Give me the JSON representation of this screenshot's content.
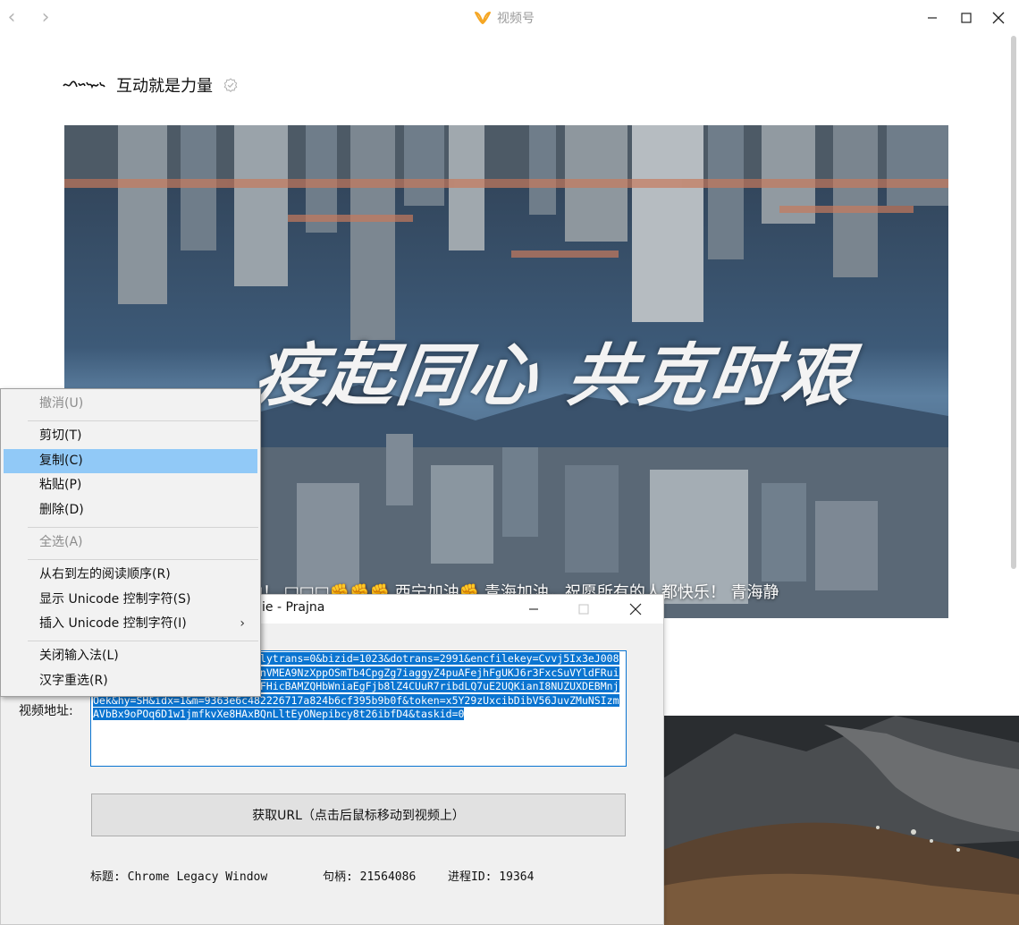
{
  "window": {
    "title": "视频号",
    "back_icon": "chevron-left-icon",
    "forward_icon": "chevron-right-icon",
    "logo_icon": "channels-logo-icon"
  },
  "post": {
    "author_name": "互动就是力量",
    "verified_icon": "verified-badge-icon",
    "avatar_icon": "handwritten-logo-avatar",
    "video_overlay_text": "疫起同心 共克时艰",
    "danmaku_text": "西宁加油！ □□□✊✊✊ 西宁加油✊ 青海加油，祝愿所有的人都快乐！ 青海静"
  },
  "dialog": {
    "title": "ie - Prajna",
    "url_label": "视频地址:",
    "url_value": "om/251/20302/stodownload?X-lytrans=0&bizid=1023&dotrans=2991&encfilekey=Cvvj5Ix3eJ00808a7aXgoTGR4hoqgnC4WQz8kVyxnVMEA9NzXppOSmTb4CpgZg7iaggyZ4puAFejhFgUKJ6r3FxcSuVYldFRuibSRNoFFWf7jTcqWld9hPaOPkXFFFHicBAMZQHbWniaEgFjb8lZ4CUuR7ribdLQ7uE2UQKianI8NUZUXDEBMnjOek&hy=SH&idx=1&m=9363e6c482226717a824b6cf395b9b0f&token=x5Y29zUxcibDibV56JuvZMuNSIzmAVbBx9oPOq6D1w1jmfkvXe8HAxBQnLltEyONepibcy8t26ibfD4&taskid=0",
    "get_url_button": "获取URL（点击后鼠标移动到视频上）",
    "status_title": "标题: Chrome Legacy Window",
    "status_handle": "句柄: 21564086",
    "status_pid": "进程ID: 19364"
  },
  "context_menu": {
    "items": [
      {
        "label": "撤消(U)"
      },
      {
        "label": "剪切(T)"
      },
      {
        "label": "复制(C)"
      },
      {
        "label": "粘贴(P)"
      },
      {
        "label": "删除(D)"
      },
      {
        "label": "全选(A)"
      },
      {
        "label": "从右到左的阅读顺序(R)"
      },
      {
        "label": "显示 Unicode 控制字符(S)"
      },
      {
        "label": "插入 Unicode 控制字符(I)"
      },
      {
        "label": "关闭输入法(L)"
      },
      {
        "label": "汉字重选(R)"
      }
    ]
  },
  "colors": {
    "selection_highlight": "#91c9f7",
    "text_selection": "#0a74d0",
    "brand_orange": "#f5a623"
  }
}
